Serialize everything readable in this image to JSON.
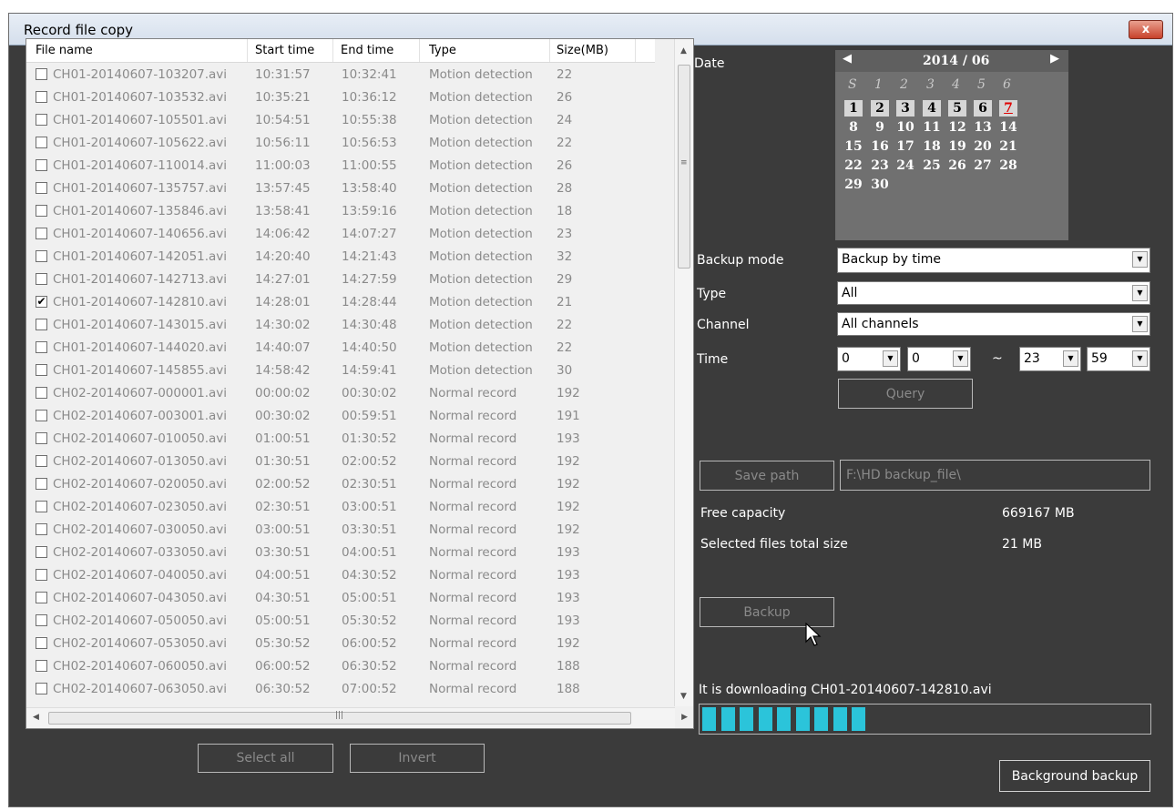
{
  "window": {
    "title": "Record file copy",
    "close_glyph": "x"
  },
  "list": {
    "columns": [
      "File name",
      "Start time",
      "End time",
      "Type",
      "Size(MB)"
    ],
    "rows": [
      {
        "checked": false,
        "name": "CH01-20140607-103207.avi",
        "start": "10:31:57",
        "end": "10:32:41",
        "type": "Motion detection",
        "size": "22"
      },
      {
        "checked": false,
        "name": "CH01-20140607-103532.avi",
        "start": "10:35:21",
        "end": "10:36:12",
        "type": "Motion detection",
        "size": "26"
      },
      {
        "checked": false,
        "name": "CH01-20140607-105501.avi",
        "start": "10:54:51",
        "end": "10:55:38",
        "type": "Motion detection",
        "size": "24"
      },
      {
        "checked": false,
        "name": "CH01-20140607-105622.avi",
        "start": "10:56:11",
        "end": "10:56:53",
        "type": "Motion detection",
        "size": "22"
      },
      {
        "checked": false,
        "name": "CH01-20140607-110014.avi",
        "start": "11:00:03",
        "end": "11:00:55",
        "type": "Motion detection",
        "size": "26"
      },
      {
        "checked": false,
        "name": "CH01-20140607-135757.avi",
        "start": "13:57:45",
        "end": "13:58:40",
        "type": "Motion detection",
        "size": "28"
      },
      {
        "checked": false,
        "name": "CH01-20140607-135846.avi",
        "start": "13:58:41",
        "end": "13:59:16",
        "type": "Motion detection",
        "size": "18"
      },
      {
        "checked": false,
        "name": "CH01-20140607-140656.avi",
        "start": "14:06:42",
        "end": "14:07:27",
        "type": "Motion detection",
        "size": "23"
      },
      {
        "checked": false,
        "name": "CH01-20140607-142051.avi",
        "start": "14:20:40",
        "end": "14:21:43",
        "type": "Motion detection",
        "size": "32"
      },
      {
        "checked": false,
        "name": "CH01-20140607-142713.avi",
        "start": "14:27:01",
        "end": "14:27:59",
        "type": "Motion detection",
        "size": "29"
      },
      {
        "checked": true,
        "name": "CH01-20140607-142810.avi",
        "start": "14:28:01",
        "end": "14:28:44",
        "type": "Motion detection",
        "size": "21"
      },
      {
        "checked": false,
        "name": "CH01-20140607-143015.avi",
        "start": "14:30:02",
        "end": "14:30:48",
        "type": "Motion detection",
        "size": "22"
      },
      {
        "checked": false,
        "name": "CH01-20140607-144020.avi",
        "start": "14:40:07",
        "end": "14:40:50",
        "type": "Motion detection",
        "size": "22"
      },
      {
        "checked": false,
        "name": "CH01-20140607-145855.avi",
        "start": "14:58:42",
        "end": "14:59:41",
        "type": "Motion detection",
        "size": "30"
      },
      {
        "checked": false,
        "name": "CH02-20140607-000001.avi",
        "start": "00:00:02",
        "end": "00:30:02",
        "type": "Normal record",
        "size": "192"
      },
      {
        "checked": false,
        "name": "CH02-20140607-003001.avi",
        "start": "00:30:02",
        "end": "00:59:51",
        "type": "Normal record",
        "size": "191"
      },
      {
        "checked": false,
        "name": "CH02-20140607-010050.avi",
        "start": "01:00:51",
        "end": "01:30:52",
        "type": "Normal record",
        "size": "193"
      },
      {
        "checked": false,
        "name": "CH02-20140607-013050.avi",
        "start": "01:30:51",
        "end": "02:00:52",
        "type": "Normal record",
        "size": "192"
      },
      {
        "checked": false,
        "name": "CH02-20140607-020050.avi",
        "start": "02:00:52",
        "end": "02:30:51",
        "type": "Normal record",
        "size": "192"
      },
      {
        "checked": false,
        "name": "CH02-20140607-023050.avi",
        "start": "02:30:51",
        "end": "03:00:51",
        "type": "Normal record",
        "size": "192"
      },
      {
        "checked": false,
        "name": "CH02-20140607-030050.avi",
        "start": "03:00:51",
        "end": "03:30:51",
        "type": "Normal record",
        "size": "192"
      },
      {
        "checked": false,
        "name": "CH02-20140607-033050.avi",
        "start": "03:30:51",
        "end": "04:00:51",
        "type": "Normal record",
        "size": "193"
      },
      {
        "checked": false,
        "name": "CH02-20140607-040050.avi",
        "start": "04:00:51",
        "end": "04:30:52",
        "type": "Normal record",
        "size": "193"
      },
      {
        "checked": false,
        "name": "CH02-20140607-043050.avi",
        "start": "04:30:51",
        "end": "05:00:51",
        "type": "Normal record",
        "size": "193"
      },
      {
        "checked": false,
        "name": "CH02-20140607-050050.avi",
        "start": "05:00:51",
        "end": "05:30:52",
        "type": "Normal record",
        "size": "193"
      },
      {
        "checked": false,
        "name": "CH02-20140607-053050.avi",
        "start": "05:30:52",
        "end": "06:00:52",
        "type": "Normal record",
        "size": "192"
      },
      {
        "checked": false,
        "name": "CH02-20140607-060050.avi",
        "start": "06:00:52",
        "end": "06:30:52",
        "type": "Normal record",
        "size": "188"
      },
      {
        "checked": false,
        "name": "CH02-20140607-063050.avi",
        "start": "06:30:52",
        "end": "07:00:52",
        "type": "Normal record",
        "size": "188"
      }
    ]
  },
  "buttons": {
    "select_all": "Select all",
    "invert": "Invert",
    "query": "Query",
    "save_path": "Save path",
    "backup": "Backup",
    "background_backup": "Background backup"
  },
  "calendar": {
    "label": "Date",
    "month": "2014 / 06",
    "weekdays": [
      "S",
      "1",
      "2",
      "3",
      "4",
      "5",
      "6"
    ],
    "weeks": [
      [
        "1",
        "2",
        "3",
        "4",
        "5",
        "6",
        "7"
      ],
      [
        "8",
        "9",
        "10",
        "11",
        "12",
        "13",
        "14"
      ],
      [
        "15",
        "16",
        "17",
        "18",
        "19",
        "20",
        "21"
      ],
      [
        "22",
        "23",
        "24",
        "25",
        "26",
        "27",
        "28"
      ],
      [
        "29",
        "30"
      ]
    ],
    "highlighted_days": [
      "1",
      "2",
      "3",
      "4",
      "5",
      "6",
      "7"
    ],
    "selected_day": "7",
    "selected_color": "#e00000"
  },
  "form": {
    "backup_mode_label": "Backup mode",
    "backup_mode_value": "Backup by time",
    "type_label": "Type",
    "type_value": "All",
    "channel_label": "Channel",
    "channel_value": "All channels",
    "time_label": "Time",
    "time_start_hour": "0",
    "time_start_min": "0",
    "time_sep": "~",
    "time_end_hour": "23",
    "time_end_min": "59",
    "save_path_value": "F:\\HD backup_file\\",
    "free_capacity_label": "Free capacity",
    "free_capacity_value": "669167 MB",
    "selected_size_label": "Selected files total size",
    "selected_size_value": "21 MB",
    "status_text": "It is downloading CH01-20140607-142810.avi"
  },
  "progress": {
    "filled_segments": 9,
    "total_segments": 29,
    "color": "#2bc4da"
  }
}
